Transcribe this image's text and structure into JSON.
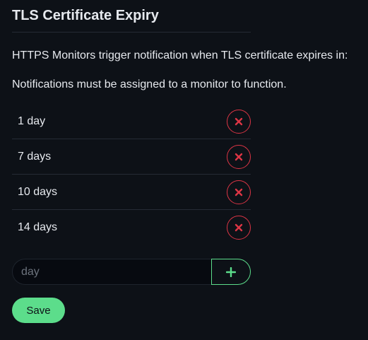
{
  "section": {
    "title": "TLS Certificate Expiry",
    "description": "HTTPS Monitors trigger notification when TLS certificate expires in:",
    "note": "Notifications must be assigned to a monitor to function."
  },
  "expiry_days": [
    {
      "label": "1 day"
    },
    {
      "label": "7 days"
    },
    {
      "label": "10 days"
    },
    {
      "label": "14 days"
    }
  ],
  "add_form": {
    "placeholder": "day",
    "add_icon": "plus-icon"
  },
  "remove_icon": "x-icon",
  "save_label": "Save",
  "colors": {
    "background": "#0d1117",
    "accent": "#5cdd8b",
    "danger": "#dc3545",
    "text": "#e6e9ee"
  }
}
